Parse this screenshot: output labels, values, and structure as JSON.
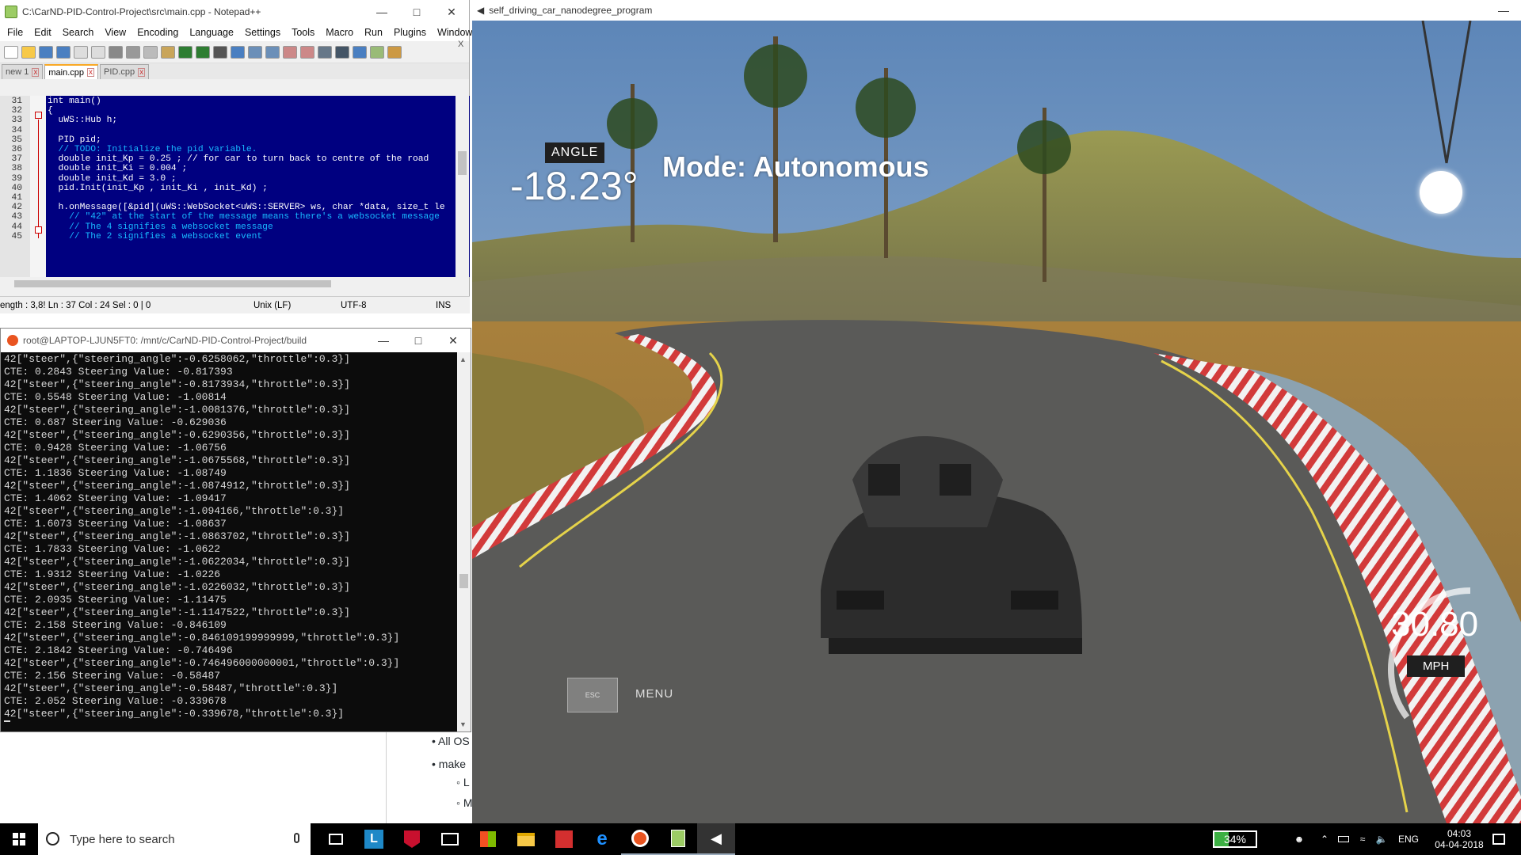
{
  "npp": {
    "title": "C:\\CarND-PID-Control-Project\\src\\main.cpp - Notepad++",
    "menu": [
      "File",
      "Edit",
      "Search",
      "View",
      "Encoding",
      "Language",
      "Settings",
      "Tools",
      "Macro",
      "Run",
      "Plugins",
      "Window",
      "?"
    ],
    "tabs": [
      "new 1",
      "main.cpp",
      "PID.cpp"
    ],
    "lines": [
      {
        "num": "31",
        "text": "int main()"
      },
      {
        "num": "32",
        "text": "{"
      },
      {
        "num": "33",
        "text": "  uWS::Hub h;"
      },
      {
        "num": "34",
        "text": ""
      },
      {
        "num": "35",
        "text": "  PID pid;"
      },
      {
        "num": "36",
        "text": "  // TODO: Initialize the pid variable."
      },
      {
        "num": "37",
        "text": "  double init_Kp = 0.25 ; // for car to turn back to centre of the road"
      },
      {
        "num": "38",
        "text": "  double init_Ki = 0.004 ;"
      },
      {
        "num": "39",
        "text": "  double init_Kd = 3.0 ;"
      },
      {
        "num": "40",
        "text": "  pid.Init(init_Kp , init_Ki , init_Kd) ;"
      },
      {
        "num": "41",
        "text": ""
      },
      {
        "num": "42",
        "text": "  h.onMessage([&pid](uWS::WebSocket<uWS::SERVER> ws, char *data, size_t le"
      },
      {
        "num": "43",
        "text": "    // \"42\" at the start of the message means there's a websocket message"
      },
      {
        "num": "44",
        "text": "    // The 4 signifies a websocket message"
      },
      {
        "num": "45",
        "text": "    // The 2 signifies a websocket event"
      }
    ],
    "status": {
      "length": "ength : 3,8! Ln : 37    Col : 24    Sel : 0 | 0",
      "eol": "Unix (LF)",
      "encoding": "UTF-8",
      "mode": "INS"
    }
  },
  "terminal": {
    "title": "root@LAPTOP-LJUN5FT0: /mnt/c/CarND-PID-Control-Project/build",
    "lines": [
      "42[\"steer\",{\"steering_angle\":-0.6258062,\"throttle\":0.3}]",
      "CTE: 0.2843 Steering Value: -0.817393",
      "42[\"steer\",{\"steering_angle\":-0.8173934,\"throttle\":0.3}]",
      "CTE: 0.5548 Steering Value: -1.00814",
      "42[\"steer\",{\"steering_angle\":-1.0081376,\"throttle\":0.3}]",
      "CTE: 0.687 Steering Value: -0.629036",
      "42[\"steer\",{\"steering_angle\":-0.6290356,\"throttle\":0.3}]",
      "CTE: 0.9428 Steering Value: -1.06756",
      "42[\"steer\",{\"steering_angle\":-1.0675568,\"throttle\":0.3}]",
      "CTE: 1.1836 Steering Value: -1.08749",
      "42[\"steer\",{\"steering_angle\":-1.0874912,\"throttle\":0.3}]",
      "CTE: 1.4062 Steering Value: -1.09417",
      "42[\"steer\",{\"steering_angle\":-1.094166,\"throttle\":0.3}]",
      "CTE: 1.6073 Steering Value: -1.08637",
      "42[\"steer\",{\"steering_angle\":-1.0863702,\"throttle\":0.3}]",
      "CTE: 1.7833 Steering Value: -1.0622",
      "42[\"steer\",{\"steering_angle\":-1.0622034,\"throttle\":0.3}]",
      "CTE: 1.9312 Steering Value: -1.0226",
      "42[\"steer\",{\"steering_angle\":-1.0226032,\"throttle\":0.3}]",
      "CTE: 2.0935 Steering Value: -1.11475",
      "42[\"steer\",{\"steering_angle\":-1.1147522,\"throttle\":0.3}]",
      "CTE: 2.158 Steering Value: -0.846109",
      "42[\"steer\",{\"steering_angle\":-0.846109199999999,\"throttle\":0.3}]",
      "CTE: 2.1842 Steering Value: -0.746496",
      "42[\"steer\",{\"steering_angle\":-0.746496000000001,\"throttle\":0.3}]",
      "CTE: 2.156 Steering Value: -0.58487",
      "42[\"steer\",{\"steering_angle\":-0.58487,\"throttle\":0.3}]",
      "CTE: 2.052 Steering Value: -0.339678",
      "42[\"steer\",{\"steering_angle\":-0.339678,\"throttle\":0.3}]"
    ]
  },
  "background": {
    "bullet1": "All OS",
    "bullet2": "make",
    "sub1": "L",
    "sub2": "M"
  },
  "sim": {
    "title": "self_driving_car_nanodegree_program",
    "angle_label": "ANGLE",
    "angle_value": "-18.23°",
    "mode": "Mode: Autonomous",
    "speed": "30.80",
    "speed_unit": "MPH",
    "esc": "ESC",
    "menu": "MENU"
  },
  "taskbar": {
    "search_placeholder": "Type here to search",
    "battery": "34%",
    "language": "ENG",
    "time": "04:03",
    "date": "04-04-2018"
  },
  "colors": {
    "editor_bg": "#000080",
    "terminal_bg": "#0c0c0c",
    "taskbar_bg": "#000000",
    "battery": "#3cb043"
  }
}
